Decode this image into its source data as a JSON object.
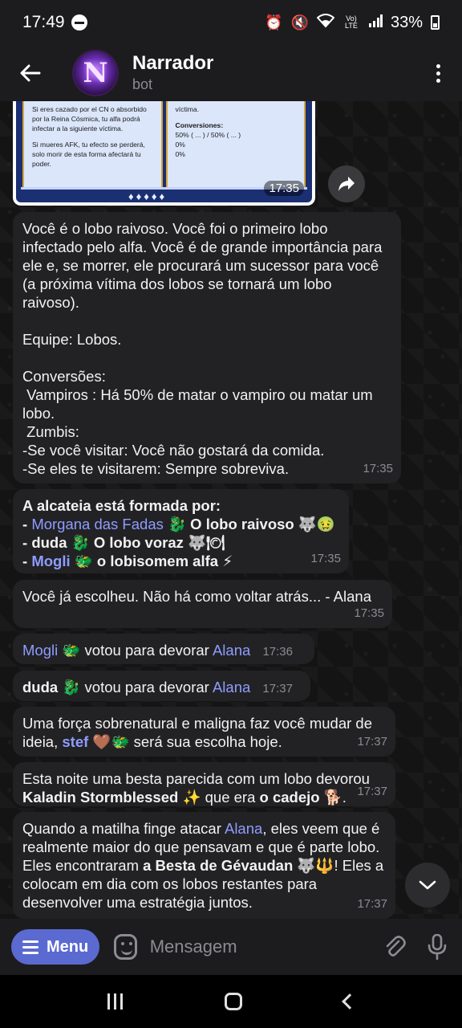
{
  "status": {
    "time": "17:49",
    "icons": [
      "dnd-icon",
      "alarm-icon",
      "mute-icon",
      "wifi-icon",
      "volte-icon",
      "signal-icon",
      "battery-icon"
    ],
    "volte": "Vo) LTE",
    "battery": "33%"
  },
  "header": {
    "back_icon": "arrow-left-icon",
    "avatar_letter": "N",
    "title": "Narrador",
    "subtitle": "bot",
    "more_icon": "more-vertical-icon"
  },
  "image_message": {
    "left_lines": [
      "Si eres cazado por el CN o absorbido por la Reina Cósmica, tu alfa podrá infectar a la siguiente víctima.",
      "Si mueres AFK, tu efecto se perderá, solo morir de esta forma afectará tu poder."
    ],
    "right_lines": [
      "víctima."
    ],
    "conversions_label": "Conversiones:",
    "conversions": [
      "50% ( ... ) / 50% ( ... )",
      "0%",
      "0%"
    ],
    "time": "17:35",
    "share_icon": "share-icon"
  },
  "messages": [
    {
      "text": "Você é o lobo raivoso. Você foi o primeiro lobo infectado pelo alfa. Você é de grande importância para ele e, se morrer, ele procurará um sucessor para você (a próxima vítima dos lobos se tornará um lobo raivoso).\n\nEquipe: Lobos.\n\nConversões:\n Vampiros : Há 50% de matar o vampiro ou matar um lobo.\n Zumbis:\n-Se você visitar: Você não gostará da comida.\n-Se eles te visitarem: Sempre sobreviva.",
      "time": "17:35"
    },
    {
      "title": "A alcateia está formada por:",
      "members": [
        {
          "prefix": "- ",
          "name": "Morgana das Fadas",
          "emoji": "🐉",
          "role": " O lobo raivoso 🐺🤢"
        },
        {
          "prefix": "- ",
          "name": "duda",
          "emoji": "🐉",
          "role": " O lobo voraz 🐺🍽"
        },
        {
          "prefix": "- ",
          "name": "Mogli",
          "emoji": "🐲",
          "role": " o lobisomem alfa ⚡"
        }
      ],
      "time": "17:35"
    },
    {
      "text": "Você já escolheu. Não há como voltar atrás... - Alana",
      "time": "17:35"
    },
    {
      "name": "Mogli",
      "emoji": "🐲",
      "text": " votou para devorar ",
      "target": "Alana",
      "time": "17:36"
    },
    {
      "name": "duda",
      "emoji": "🐉",
      "text": " votou para devorar ",
      "target": "Alana",
      "time": "17:37"
    },
    {
      "text_before": "Uma força sobrenatural e maligna faz você mudar de ideia, ",
      "name": "stef",
      "emoji": "🤎🐲",
      "text_after": " será sua escolha hoje.",
      "time": "17:37"
    },
    {
      "text_before": "Esta noite uma besta parecida com um lobo devorou ",
      "victim": "Kaladin Stormblessed",
      "victim_emoji": "✨",
      "text_mid": " que era  ",
      "role": "o cadejo",
      "role_emoji": "🐕",
      "text_after": ".",
      "time": "17:37"
    },
    {
      "text_before": "Quando a matilha finge atacar ",
      "name": "Alana",
      "text_mid": ", eles veem que é realmente maior do que pensavam e que é parte lobo. Eles encontraram ",
      "bold": "a Besta de Gévaudan 🐺🔱",
      "text_after": "! Eles a colocam em dia com os lobos restantes para desenvolver uma estratégia juntos.",
      "time": "17:37"
    }
  ],
  "input": {
    "menu_label": "Menu",
    "placeholder": "Mensagem",
    "emoji_icon": "sticker-icon",
    "attach_icon": "paperclip-icon",
    "mic_icon": "microphone-icon"
  },
  "scroll_icon": "chevron-down-icon",
  "nav": [
    "recents-icon",
    "home-icon",
    "back-icon"
  ]
}
